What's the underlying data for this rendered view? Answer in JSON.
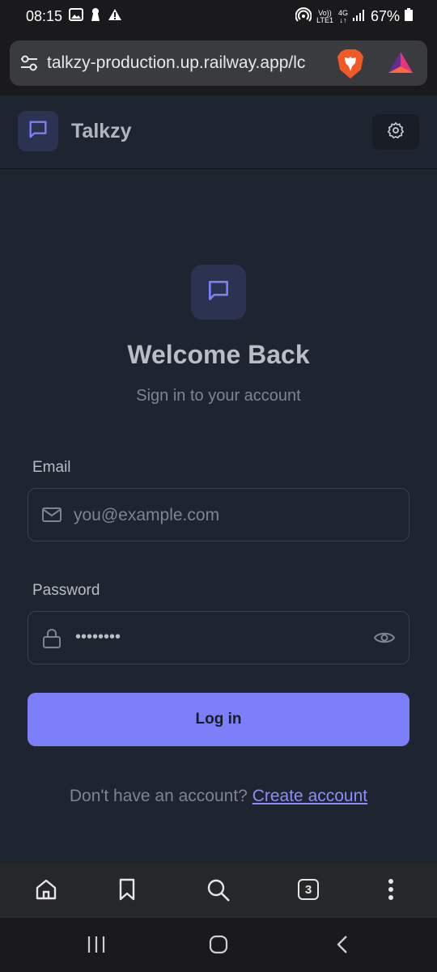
{
  "status_bar": {
    "time": "08:15",
    "volte": "Vo))",
    "lte": "LTE1",
    "network": "4G",
    "battery": "67%"
  },
  "browser": {
    "url": "talkzy-production.up.railway.app/lc",
    "tab_count": "3"
  },
  "app": {
    "name": "Talkzy"
  },
  "login": {
    "title": "Welcome Back",
    "subtitle": "Sign in to your account",
    "email_label": "Email",
    "email_placeholder": "you@example.com",
    "password_label": "Password",
    "password_value": "••••••••",
    "submit_label": "Log in",
    "signup_prompt": "Don't have an account?",
    "signup_link": "Create account"
  },
  "colors": {
    "background": "#1e2430",
    "accent": "#7c7ff8",
    "icon_tile": "#2c3350"
  }
}
